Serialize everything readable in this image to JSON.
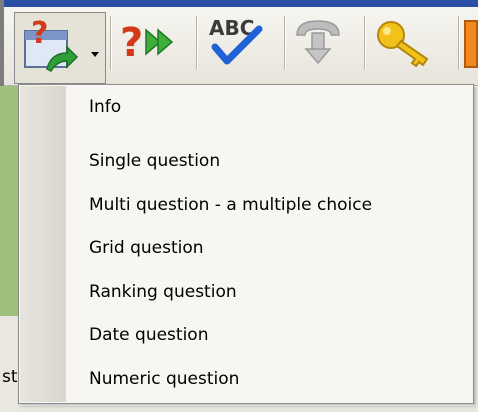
{
  "toolbar": {
    "buttons": [
      {
        "icon": "insert-question-icon",
        "has_dropdown": true
      },
      {
        "icon": "next-question-icon"
      },
      {
        "icon": "spell-check-icon",
        "text": "ABC"
      },
      {
        "icon": "download-disabled-icon"
      },
      {
        "icon": "key-icon"
      }
    ]
  },
  "background": {
    "fragment_text": "st"
  },
  "menu": {
    "items": [
      {
        "label": "Info"
      },
      {
        "label": "Single question"
      },
      {
        "label": "Multi question - a multiple choice"
      },
      {
        "label": "Grid question"
      },
      {
        "label": "Ranking question"
      },
      {
        "label": "Date question"
      },
      {
        "label": "Numeric question"
      }
    ]
  }
}
